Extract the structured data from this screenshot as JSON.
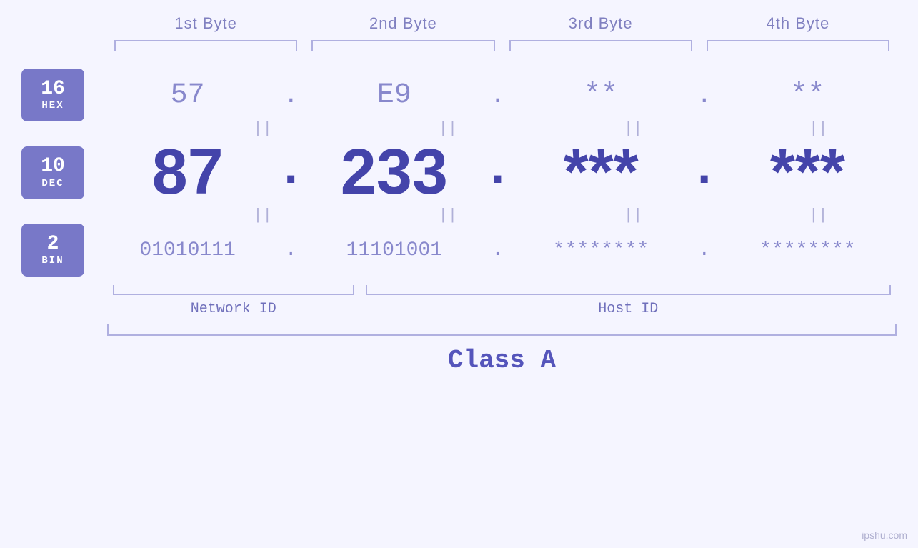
{
  "header": {
    "byte1": "1st Byte",
    "byte2": "2nd Byte",
    "byte3": "3rd Byte",
    "byte4": "4th Byte"
  },
  "hex_badge": {
    "number": "16",
    "label": "HEX"
  },
  "dec_badge": {
    "number": "10",
    "label": "DEC"
  },
  "bin_badge": {
    "number": "2",
    "label": "BIN"
  },
  "hex_values": {
    "b1": "57",
    "b2": "E9",
    "b3": "**",
    "b4": "**",
    "dot": "."
  },
  "dec_values": {
    "b1": "87",
    "b2": "233",
    "b3": "***",
    "b4": "***",
    "dot": "."
  },
  "bin_values": {
    "b1": "01010111",
    "b2": "11101001",
    "b3": "********",
    "b4": "********",
    "dot": "."
  },
  "labels": {
    "network_id": "Network ID",
    "host_id": "Host ID",
    "class": "Class A"
  },
  "watermark": "ipshu.com",
  "equals_sign": "||"
}
